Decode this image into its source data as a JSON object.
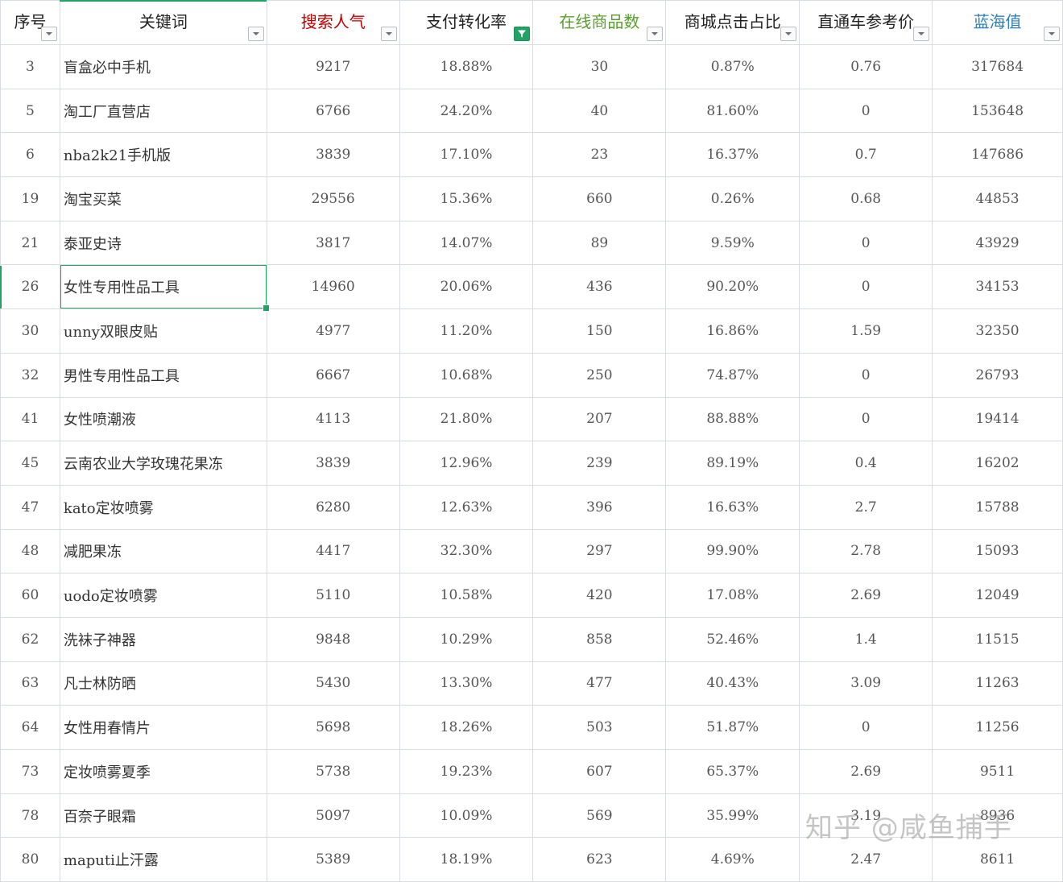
{
  "headers": [
    {
      "label": "序号",
      "color": "default",
      "filter_active": false
    },
    {
      "label": "关键词",
      "color": "default",
      "filter_active": false
    },
    {
      "label": "搜索人气",
      "color": "red",
      "filter_active": false
    },
    {
      "label": "支付转化率",
      "color": "default",
      "filter_active": true
    },
    {
      "label": "在线商品数",
      "color": "green",
      "filter_active": false
    },
    {
      "label": "商城点击占比",
      "color": "default",
      "filter_active": false
    },
    {
      "label": "直通车参考价",
      "color": "default",
      "filter_active": false
    },
    {
      "label": "蓝海值",
      "color": "blue",
      "filter_active": false
    }
  ],
  "colors": {
    "red_header": "#c00000",
    "green_header": "#5a9e2f",
    "blue_header": "#2f7fb6",
    "selection": "#21a366",
    "grid": "#d9dde1"
  },
  "selected_cell": {
    "row_index": 5,
    "column": "关键词"
  },
  "rows": [
    [
      "3",
      "盲盒必中手机",
      "9217",
      "18.88%",
      "30",
      "0.87%",
      "0.76",
      "317684"
    ],
    [
      "5",
      "淘工厂直营店",
      "6766",
      "24.20%",
      "40",
      "81.60%",
      "0",
      "153648"
    ],
    [
      "6",
      "nba2k21手机版",
      "3839",
      "17.10%",
      "23",
      "16.37%",
      "0.7",
      "147686"
    ],
    [
      "19",
      "淘宝买菜",
      "29556",
      "15.36%",
      "660",
      "0.26%",
      "0.68",
      "44853"
    ],
    [
      "21",
      "泰亚史诗",
      "3817",
      "14.07%",
      "89",
      "9.59%",
      "0",
      "43929"
    ],
    [
      "26",
      "女性专用性品工具",
      "14960",
      "20.06%",
      "436",
      "90.20%",
      "0",
      "34153"
    ],
    [
      "30",
      "unny双眼皮贴",
      "4977",
      "11.20%",
      "150",
      "16.86%",
      "1.59",
      "32350"
    ],
    [
      "32",
      "男性专用性品工具",
      "6667",
      "10.68%",
      "250",
      "74.87%",
      "0",
      "26793"
    ],
    [
      "41",
      "女性喷潮液",
      "4113",
      "21.80%",
      "207",
      "88.88%",
      "0",
      "19414"
    ],
    [
      "45",
      "云南农业大学玫瑰花果冻",
      "3839",
      "12.96%",
      "239",
      "89.19%",
      "0.4",
      "16202"
    ],
    [
      "47",
      "kato定妆喷雾",
      "6280",
      "12.63%",
      "396",
      "16.63%",
      "2.7",
      "15788"
    ],
    [
      "48",
      "减肥果冻",
      "4417",
      "32.30%",
      "297",
      "99.90%",
      "2.78",
      "15093"
    ],
    [
      "60",
      "uodo定妆喷雾",
      "5110",
      "10.58%",
      "420",
      "17.08%",
      "2.69",
      "12049"
    ],
    [
      "62",
      "洗袜子神器",
      "9848",
      "10.29%",
      "858",
      "52.46%",
      "1.4",
      "11515"
    ],
    [
      "63",
      "凡士林防晒",
      "5430",
      "13.30%",
      "477",
      "40.43%",
      "3.09",
      "11263"
    ],
    [
      "64",
      "女性用春情片",
      "5698",
      "18.26%",
      "503",
      "51.87%",
      "0",
      "11256"
    ],
    [
      "73",
      "定妆喷雾夏季",
      "5738",
      "19.23%",
      "607",
      "65.37%",
      "2.69",
      "9511"
    ],
    [
      "78",
      "百奈子眼霜",
      "5097",
      "10.09%",
      "569",
      "35.99%",
      "3.19",
      "8936"
    ],
    [
      "80",
      "maputi止汗露",
      "5389",
      "18.19%",
      "623",
      "4.69%",
      "2.47",
      "8611"
    ]
  ],
  "watermark": "知乎 @咸鱼捕手"
}
